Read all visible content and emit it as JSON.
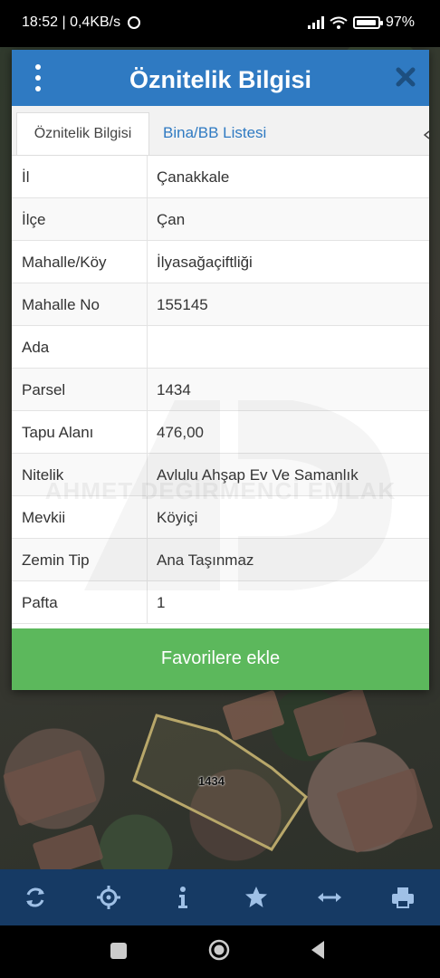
{
  "status_bar": {
    "time_speed": "18:52 | 0,4KB/s",
    "battery": "97%"
  },
  "dialog": {
    "title": "Öznitelik Bilgisi",
    "tabs": {
      "active": "Öznitelik Bilgisi",
      "inactive": "Bina/BB Listesi"
    },
    "rows": [
      {
        "key": "İl",
        "value": "Çanakkale"
      },
      {
        "key": "İlçe",
        "value": "Çan"
      },
      {
        "key": "Mahalle/Köy",
        "value": "İlyasağaçiftliği"
      },
      {
        "key": "Mahalle No",
        "value": "155145"
      },
      {
        "key": "Ada",
        "value": ""
      },
      {
        "key": "Parsel",
        "value": "1434"
      },
      {
        "key": "Tapu Alanı",
        "value": "476,00"
      },
      {
        "key": "Nitelik",
        "value": "Avlulu Ahşap Ev Ve Samanlık"
      },
      {
        "key": "Mevkii",
        "value": "Köyiçi"
      },
      {
        "key": "Zemin Tip",
        "value": "Ana Taşınmaz"
      },
      {
        "key": "Pafta",
        "value": "1"
      }
    ],
    "watermark": "AHMET DEĞİRMENCİ EMLAK",
    "favorite_button": "Favorilere ekle"
  },
  "map": {
    "parcel_label": "1434"
  },
  "toolbar": {
    "icons": [
      "refresh-icon",
      "locate-icon",
      "info-icon",
      "star-icon",
      "measure-icon",
      "print-icon"
    ],
    "accent": "#163a64"
  },
  "colors": {
    "header": "#2f7ac2",
    "button": "#5cb85c",
    "parcel_outline": "#b8a76a"
  }
}
